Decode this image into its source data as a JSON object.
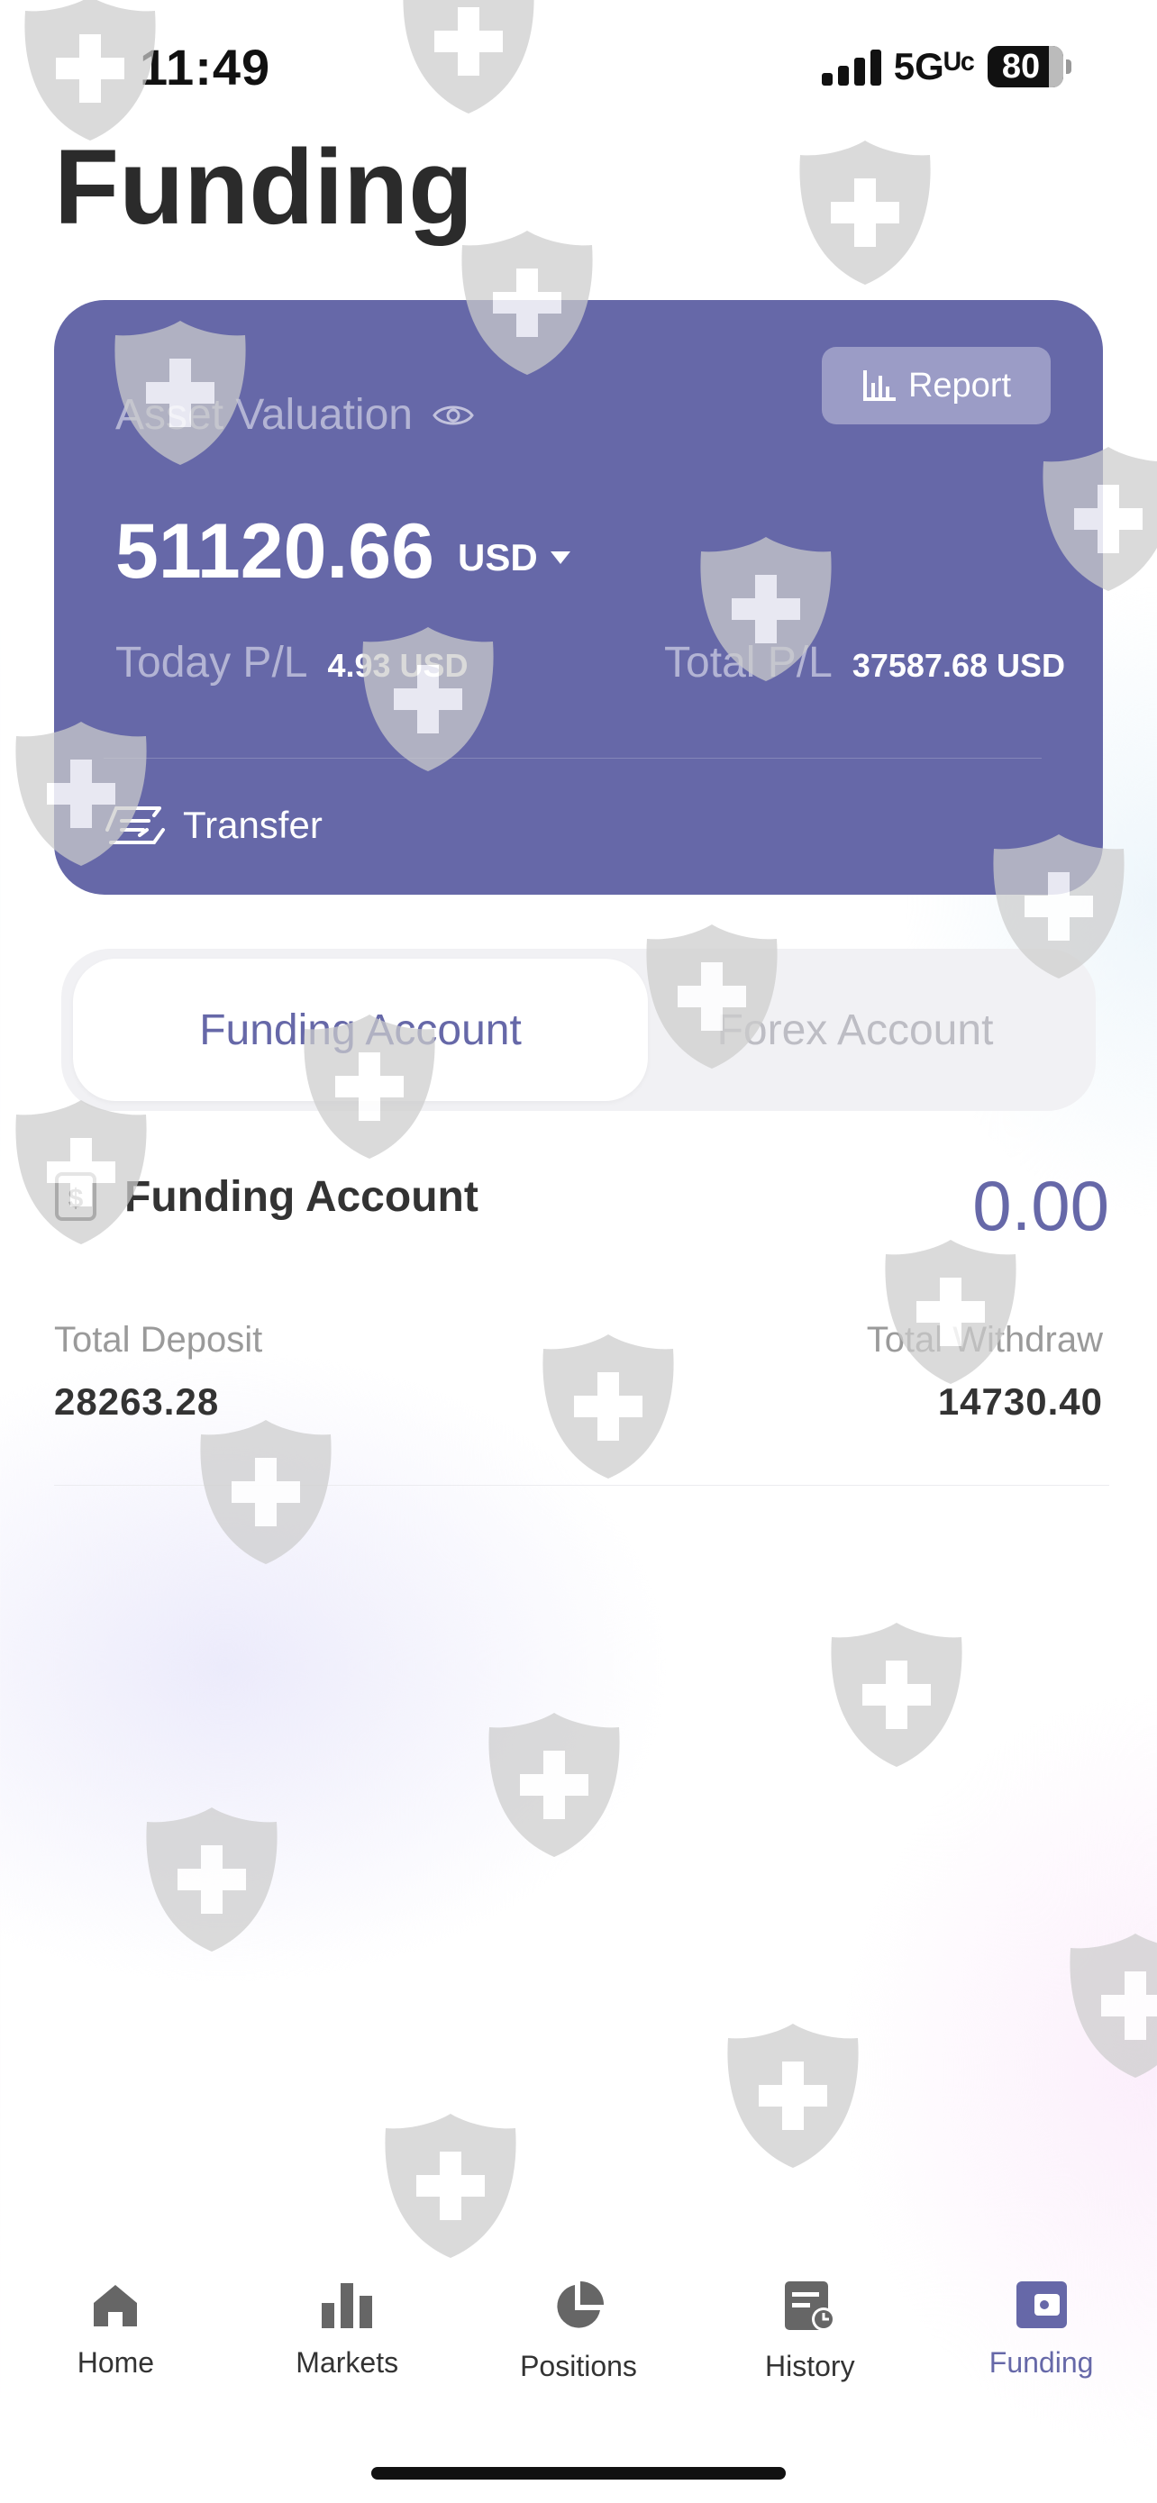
{
  "status_bar": {
    "time": "11:49",
    "network": "5Gᵁᶜ",
    "battery": "80"
  },
  "page": {
    "title": "Funding"
  },
  "asset_card": {
    "report_label": "Report",
    "valuation_label": "Asset Valuation",
    "value": "51120.66",
    "currency": "USD",
    "today_pl_label": "Today P/L",
    "today_pl_value": "4.93 USD",
    "total_pl_label": "Total P/L",
    "total_pl_value": "37587.68 USD",
    "transfer_label": "Transfer"
  },
  "account_tabs": [
    {
      "label": "Funding Account",
      "active": true
    },
    {
      "label": "Forex Account",
      "active": false
    }
  ],
  "funding_account": {
    "title": "Funding Account",
    "amount": "0.00",
    "total_deposit_label": "Total Deposit",
    "total_deposit_value": "28263.28",
    "total_withdraw_label": "Total Withdraw",
    "total_withdraw_value": "14730.40"
  },
  "tabbar": [
    {
      "label": "Home",
      "icon": "home-icon"
    },
    {
      "label": "Markets",
      "icon": "bar-chart-icon"
    },
    {
      "label": "Positions",
      "icon": "pie-chart-icon"
    },
    {
      "label": "History",
      "icon": "history-icon"
    },
    {
      "label": "Funding",
      "icon": "wallet-icon",
      "active": true
    }
  ],
  "colors": {
    "accent": "#6668a8",
    "card": "#6668a8"
  }
}
